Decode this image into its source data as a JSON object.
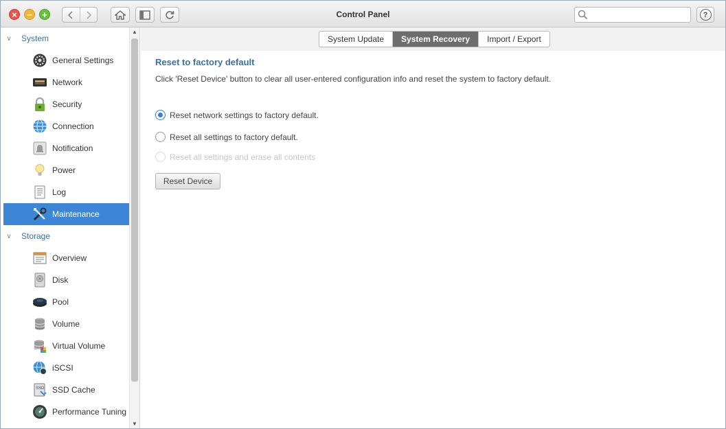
{
  "window": {
    "title": "Control Panel"
  },
  "toolbar": {
    "back_icon": "chevron-left-icon",
    "forward_icon": "chevron-right-icon",
    "home_icon": "home-icon",
    "sidebar_toggle_icon": "sidebar-toggle-icon",
    "refresh_icon": "refresh-icon",
    "help_label": "?"
  },
  "search": {
    "value": "",
    "placeholder": ""
  },
  "sidebar": {
    "groups": [
      {
        "label": "System",
        "items": [
          {
            "label": "General Settings",
            "icon": "gear-icon",
            "active": false
          },
          {
            "label": "Network",
            "icon": "network-icon",
            "active": false
          },
          {
            "label": "Security",
            "icon": "lock-icon",
            "active": false
          },
          {
            "label": "Connection",
            "icon": "globe-icon",
            "active": false
          },
          {
            "label": "Notification",
            "icon": "bell-icon",
            "active": false
          },
          {
            "label": "Power",
            "icon": "lightbulb-icon",
            "active": false
          },
          {
            "label": "Log",
            "icon": "log-icon",
            "active": false
          },
          {
            "label": "Maintenance",
            "icon": "tools-icon",
            "active": true
          }
        ]
      },
      {
        "label": "Storage",
        "items": [
          {
            "label": "Overview",
            "icon": "overview-icon"
          },
          {
            "label": "Disk",
            "icon": "disk-icon"
          },
          {
            "label": "Pool",
            "icon": "pool-icon"
          },
          {
            "label": "Volume",
            "icon": "volume-icon"
          },
          {
            "label": "Virtual Volume",
            "icon": "virtual-volume-icon"
          },
          {
            "label": "iSCSI",
            "icon": "iscsi-icon"
          },
          {
            "label": "SSD Cache",
            "icon": "ssd-icon"
          },
          {
            "label": "Performance Tuning",
            "icon": "performance-icon"
          }
        ]
      }
    ]
  },
  "tabs": [
    {
      "label": "System Update",
      "active": false
    },
    {
      "label": "System Recovery",
      "active": true
    },
    {
      "label": "Import / Export",
      "active": false
    }
  ],
  "recovery": {
    "title": "Reset to factory default",
    "description": "Click 'Reset Device' button to clear all user-entered configuration info and reset the system to factory default.",
    "options": [
      {
        "label": "Reset network settings to factory default.",
        "checked": true,
        "disabled": false
      },
      {
        "label": "Reset all settings to factory default.",
        "checked": false,
        "disabled": false
      },
      {
        "label": "Reset all settings and erase all contents",
        "checked": false,
        "disabled": true
      }
    ],
    "button_label": "Reset Device"
  },
  "colors": {
    "accent": "#3d86d6",
    "heading": "#3c6ea6",
    "active_tab": "#6d6d6d"
  }
}
